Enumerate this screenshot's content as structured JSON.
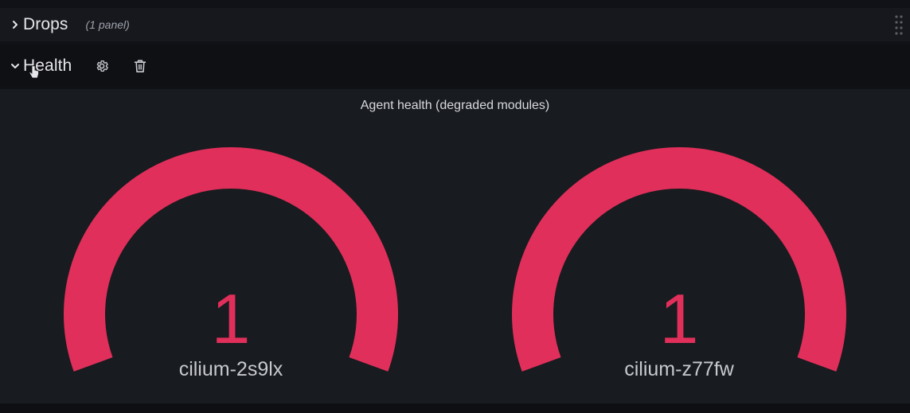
{
  "rows": {
    "drops": {
      "title": "Drops",
      "count": "(1 panel)",
      "collapsed": true
    },
    "health": {
      "title": "Health",
      "collapsed": false
    }
  },
  "icons": {
    "expand": "chevron-right-icon",
    "collapse": "chevron-down-icon",
    "settings": "gear-icon",
    "delete": "trash-icon",
    "drag": "drag-handle-icon"
  },
  "panel": {
    "title": "Agent health (degraded modules)",
    "gauges": [
      {
        "value": "1",
        "label": "cilium-2s9lx",
        "fraction": 1.0
      },
      {
        "value": "1",
        "label": "cilium-z77fw",
        "fraction": 1.0
      }
    ]
  },
  "colors": {
    "gauge_red": "#e02f5a",
    "background": "#111217",
    "panel_background": "#181b1f"
  }
}
